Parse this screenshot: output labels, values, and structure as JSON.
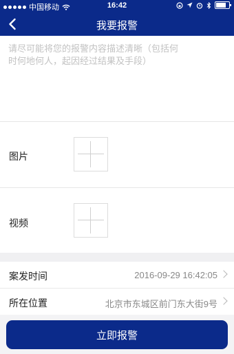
{
  "status_bar": {
    "carrier": "中国移动",
    "time": "16:42"
  },
  "navbar": {
    "title": "我要报警"
  },
  "description": {
    "placeholder": "请尽可能将您的报警内容描述清晰（包括何时何地何人，起因经过结果及手段）"
  },
  "media": {
    "image_label": "图片",
    "video_label": "视频"
  },
  "details": {
    "time_label": "案发时间",
    "time_value": "2016-09-29 16:42:05",
    "location_label": "所在位置",
    "location_value": "北京市东城区前门东大街9号"
  },
  "actions": {
    "submit_label": "立即报警"
  },
  "colors": {
    "brand": "#0b2a8a",
    "placeholder": "#c2c2c2",
    "secondary_text": "#888888"
  }
}
